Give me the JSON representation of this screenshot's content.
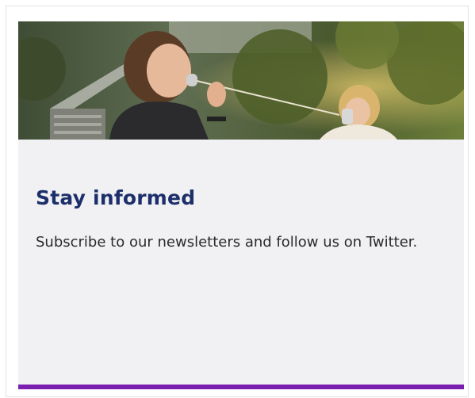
{
  "card": {
    "title": "Stay informed",
    "description": "Subscribe to our newsletters and follow us on Twitter.",
    "accent_color": "#7a1fb0",
    "title_color": "#1d2f6a",
    "background_color": "#f1f1f4"
  }
}
